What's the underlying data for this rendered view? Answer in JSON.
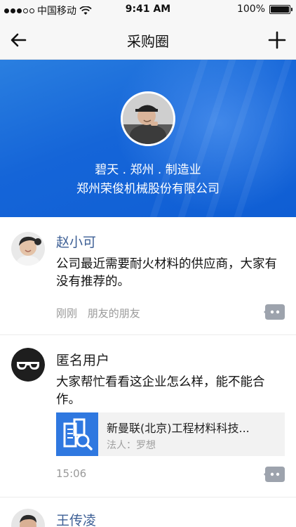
{
  "status_bar": {
    "carrier": "中国移动",
    "time": "9:41 AM",
    "battery": "100%",
    "signal_icon": "signal-dots-icon",
    "wifi_icon": "wifi-icon",
    "battery_icon": "battery-icon"
  },
  "nav": {
    "title": "采购圈",
    "back_icon": "arrow-left-icon",
    "add_icon": "plus-icon"
  },
  "banner": {
    "line1": "碧天 . 郑州 . 制造业",
    "line2": "郑州荣俊机械股份有限公司",
    "accent_color": "#1565d8"
  },
  "posts": [
    {
      "name": "赵小可",
      "text": "公司最近需要耐火材料的供应商，大家有没有推荐的。",
      "time": "刚刚",
      "relation": "朋友的朋友"
    },
    {
      "name": "匿名用户",
      "text": "大家帮忙看看这企业怎么样，能不能合作。",
      "share": {
        "title": "新曼联(北京)工程材料科技...",
        "subtitle": "法人：罗想"
      },
      "time": "15:06"
    },
    {
      "name": "王传凌"
    }
  ],
  "colors": {
    "name_blue": "#3d5f95",
    "name_dark": "#222222",
    "meta_gray": "#9a9a9a"
  }
}
